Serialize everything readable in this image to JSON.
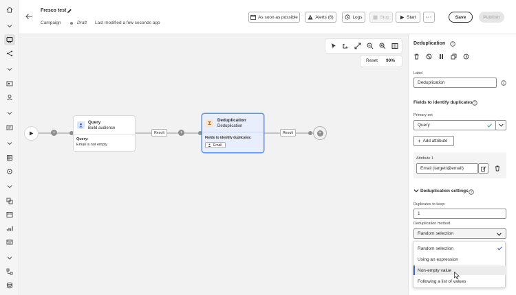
{
  "header": {
    "title": "Fresco test",
    "breadcrumb": "Campaign",
    "status": "Draft",
    "last_modified": "Last modified a few seconds ago",
    "buttons": {
      "schedule": "As soon as possible",
      "alerts": "Alerts (6)",
      "logs": "Logs",
      "stop": "Stop",
      "start": "Start",
      "save": "Save",
      "publish": "Publish"
    }
  },
  "canvas": {
    "toolbar": {
      "reset": "Reset",
      "zoom": "90%"
    },
    "nodes": {
      "query": {
        "title": "Query",
        "subtitle": "Build audience",
        "detail_label": "Query:",
        "detail_value": "Email is not empty"
      },
      "dedup": {
        "title": "Deduplication",
        "subtitle": "Deduplication",
        "detail_label": "Fields to identify duplicates:",
        "chip": "Email"
      }
    },
    "transitions": [
      "Result",
      "Result"
    ]
  },
  "panel": {
    "title": "Deduplication",
    "label_caption": "Label",
    "label_value": "Deduplication",
    "fields_section": "Fields to identify duplicates",
    "primary_set_caption": "Primary set",
    "primary_set_value": "Query",
    "add_attribute": "Add attribute",
    "attribute_caption": "Attribute 1",
    "attribute_value": "Email (target/@email)",
    "settings_section": "Deduplication settings",
    "dup_keep_caption": "Duplicates to keep",
    "dup_keep_value": "1",
    "method_caption": "Deduplication method",
    "method_value": "Random selection",
    "method_options": [
      "Random selection",
      "Using an expression",
      "Non-empty value",
      "Following a list of values"
    ]
  },
  "colors": {
    "accent": "#5d8ff0",
    "selected_bg": "#e8eefb",
    "canvas_bg": "#f2f2f2",
    "check": "#2d9d78"
  }
}
